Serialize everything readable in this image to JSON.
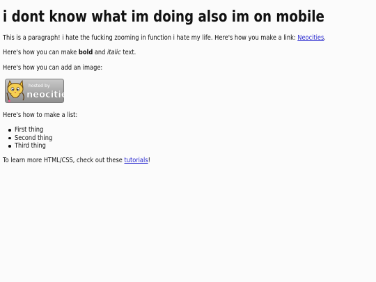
{
  "title": "i dont know what im doing also im on mobile",
  "intro": {
    "text": "This is a paragraph! i hate the fucking zooming in function i hate my life. Here's how you make a link: ",
    "link_label": "Neocities",
    "after_link": "."
  },
  "formatting": {
    "before": "Here's how you can make ",
    "bold": "bold",
    "middle": " and ",
    "italic": "italic",
    "after": " text."
  },
  "image_intro": "Here's how you can add an image:",
  "badge": {
    "line1": "hosted by",
    "line2": "neocities"
  },
  "list_intro": "Here's how to make a list:",
  "list_items": [
    "First thing",
    "Second thing",
    "Third thing"
  ],
  "outro": {
    "text": "To learn more HTML/CSS, check out these ",
    "link_label": "tutorials",
    "after_link": "!"
  },
  "colors": {
    "background": "#fbfbfb",
    "text": "#111111",
    "link": "#2a2ad0"
  },
  "icons": [
    "neocities-cat-logo"
  ]
}
